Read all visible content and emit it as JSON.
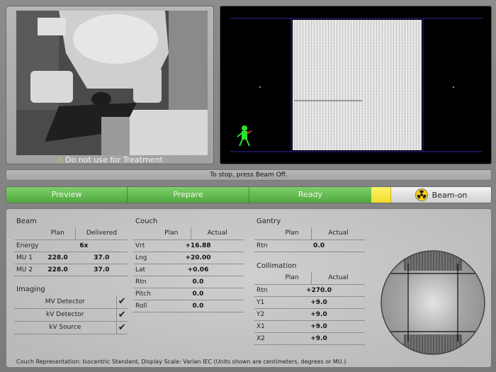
{
  "camera": {
    "caption": "Do not use for Treatment",
    "warning_icon": "warning-triangle-icon"
  },
  "status": {
    "message": "To stop, press Beam Off."
  },
  "workflow": {
    "preview_label": "Preview",
    "prepare_label": "Prepare",
    "ready_label": "Ready",
    "beam_on_label": "Beam-on",
    "beam_on_icon": "radiation-icon",
    "colors": {
      "green": "#5db84a",
      "yellow": "#f6e640"
    }
  },
  "beam": {
    "title": "Beam",
    "col_plan": "Plan",
    "col_delivered": "Delivered",
    "energy_label": "Energy",
    "energy_value": "6x",
    "mu1_label": "MU 1",
    "mu1_plan": "228.0",
    "mu1_delivered": "37.0",
    "mu2_label": "MU 2",
    "mu2_plan": "228.0",
    "mu2_delivered": "37.0"
  },
  "imaging": {
    "title": "Imaging",
    "rows": [
      {
        "label": "MV Detector",
        "check": "✔"
      },
      {
        "label": "kV Detector",
        "check": "✔"
      },
      {
        "label": "kV Source",
        "check": "✔"
      }
    ]
  },
  "couch": {
    "title": "Couch",
    "col_plan": "Plan",
    "col_actual": "Actual",
    "rows": [
      {
        "label": "Vrt",
        "value": "+16.88"
      },
      {
        "label": "Lng",
        "value": "+20.00"
      },
      {
        "label": "Lat",
        "value": "+0.06"
      },
      {
        "label": "Rtn",
        "value": "0.0"
      },
      {
        "label": "Pitch",
        "value": "0.0"
      },
      {
        "label": "Roll",
        "value": "0.0"
      }
    ]
  },
  "gantry": {
    "title": "Gantry",
    "col_plan": "Plan",
    "col_actual": "Actual",
    "rtn_label": "Rtn",
    "rtn_value": "0.0"
  },
  "collimation": {
    "title": "Collimation",
    "col_plan": "Plan",
    "col_actual": "Actual",
    "rows": [
      {
        "label": "Rtn",
        "value": "+270.0"
      },
      {
        "label": "Y1",
        "value": "+9.0"
      },
      {
        "label": "Y2",
        "value": "+9.0"
      },
      {
        "label": "X1",
        "value": "+9.0"
      },
      {
        "label": "X2",
        "value": "+9.0"
      }
    ]
  },
  "footer": {
    "note": "Couch Representation: Isocentric Standard, Display Scale: Varian IEC (Units shown are centimeters, degrees or MU.)"
  }
}
